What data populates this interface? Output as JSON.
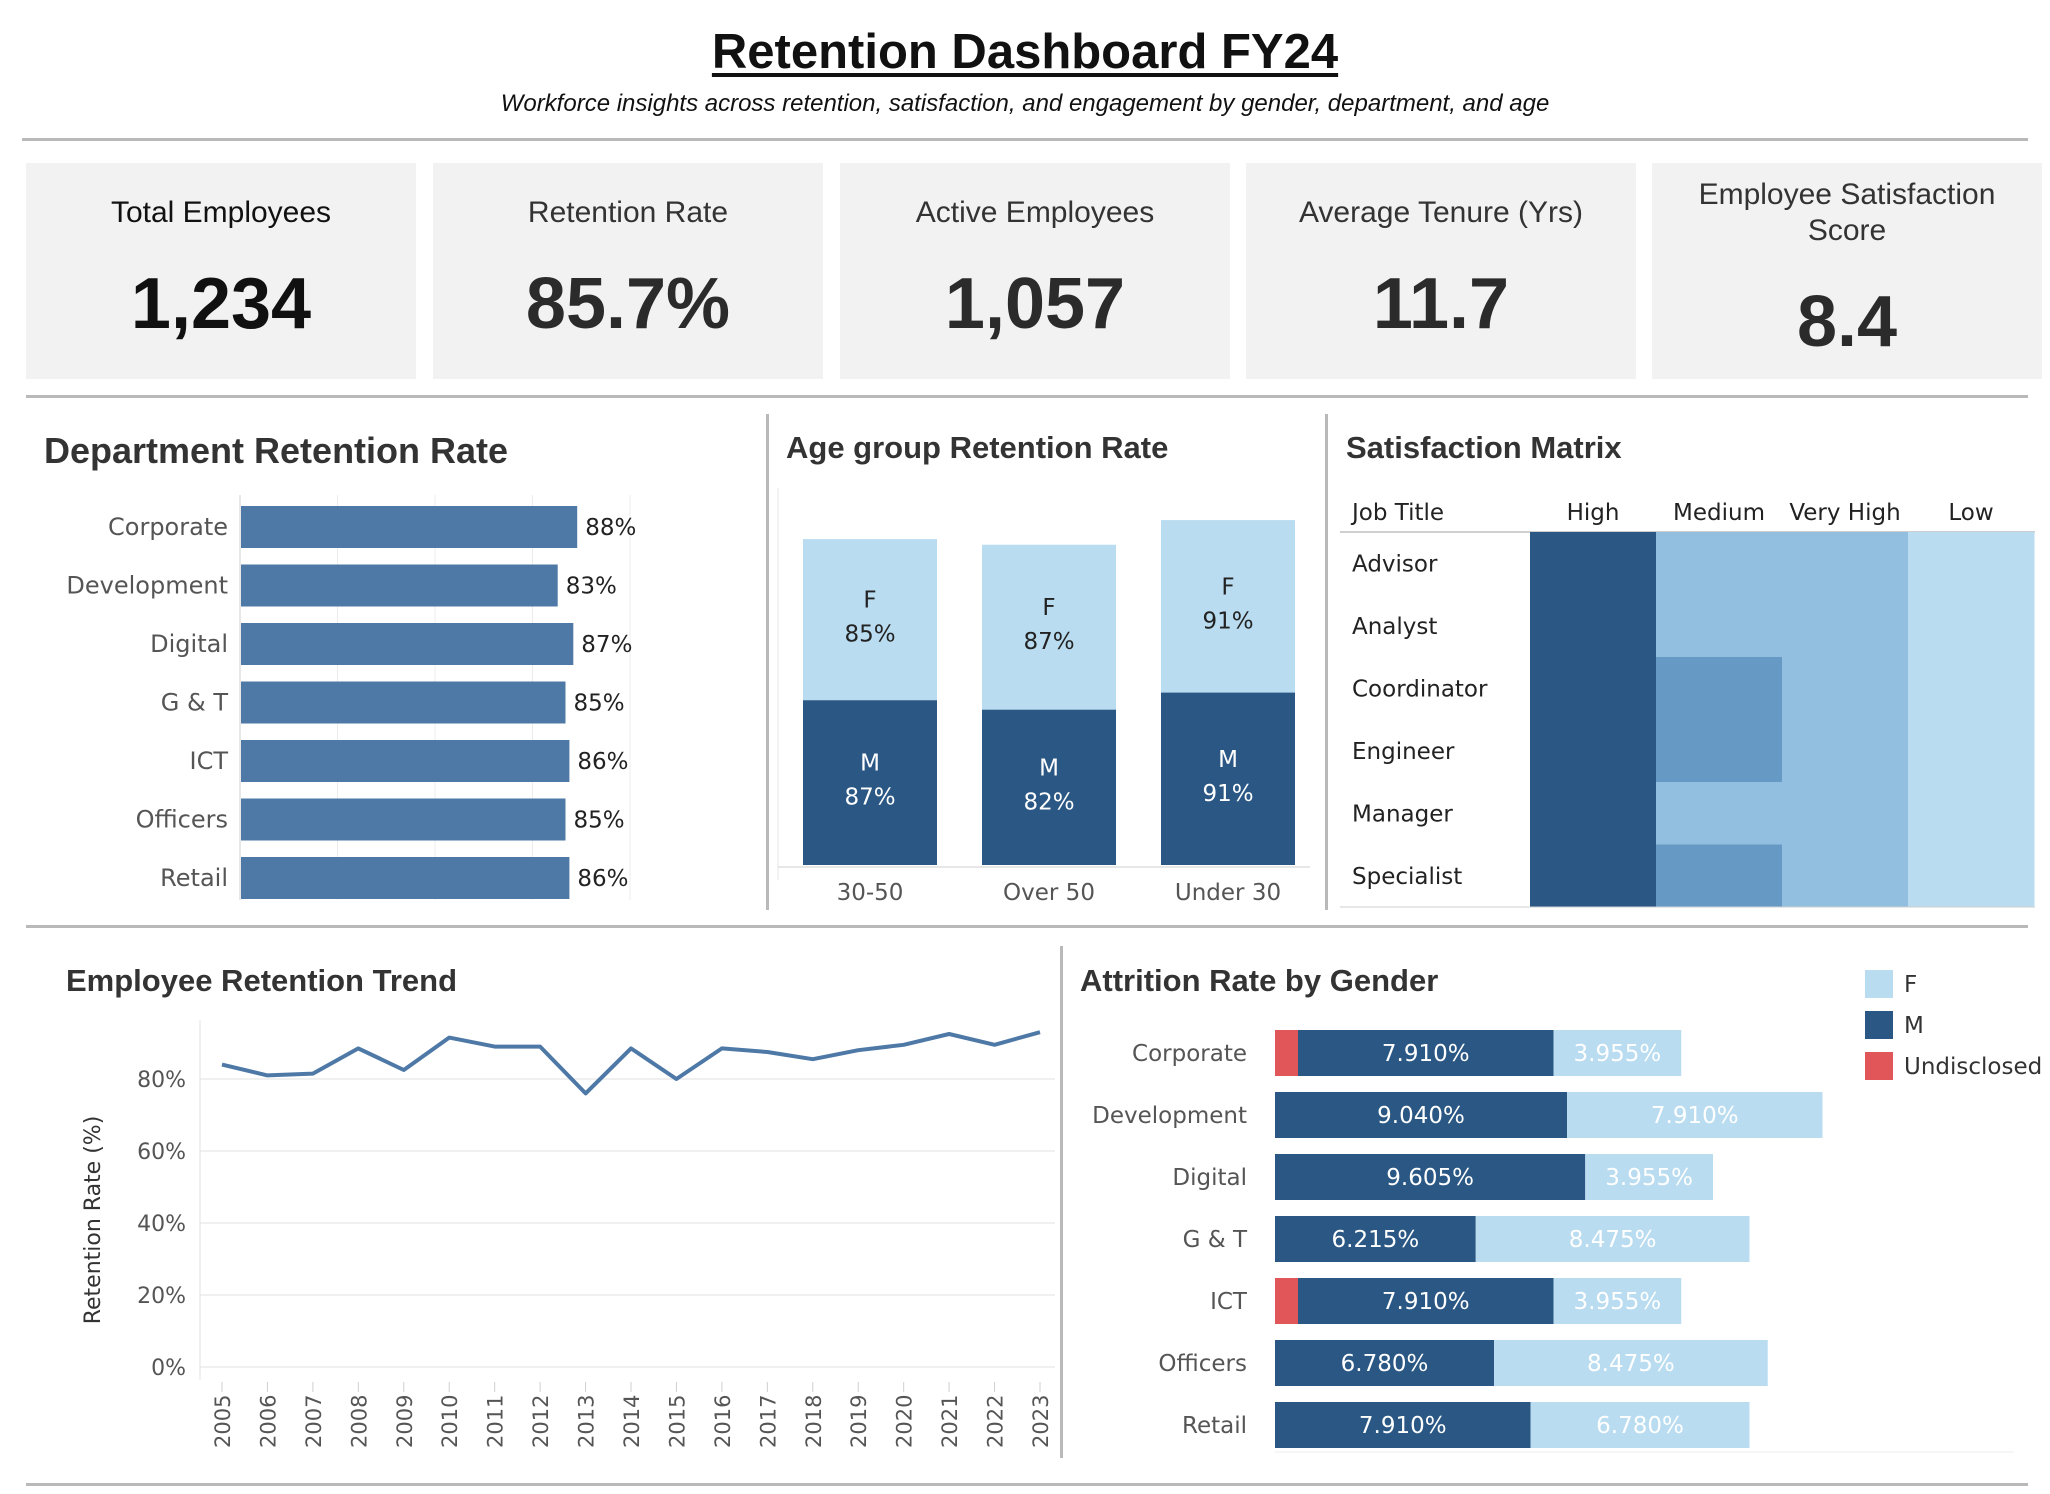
{
  "header": {
    "title": "Retention Dashboard FY24",
    "subtitle": "Workforce insights across retention, satisfaction, and engagement by gender, department, and age"
  },
  "kpis": [
    {
      "label": "Total Employees",
      "value": "1,234"
    },
    {
      "label": "Retention Rate",
      "value": "85.7%"
    },
    {
      "label": "Active Employees",
      "value": "1,057"
    },
    {
      "label": "Average Tenure (Yrs)",
      "value": "11.7"
    },
    {
      "label": "Employee Satisfaction Score",
      "value": "8.4"
    }
  ],
  "colors": {
    "bar_blue": "#4e79a7",
    "dark_blue": "#2a5783",
    "light_blue": "#b9dcf0",
    "mid_blue": "#6699c4",
    "matrix_light": "#92bfe0",
    "red": "#e15759",
    "line_blue": "#4e79a7"
  },
  "chart_data": [
    {
      "id": "dept",
      "type": "bar",
      "title": "Department Retention Rate",
      "orientation": "horizontal",
      "categories": [
        "Corporate",
        "Development",
        "Digital",
        "G & T",
        "ICT",
        "Officers",
        "Retail"
      ],
      "values": [
        88,
        83,
        87,
        85,
        86,
        85,
        86
      ],
      "value_labels": [
        "88%",
        "83%",
        "87%",
        "85%",
        "86%",
        "85%",
        "86%"
      ],
      "xlim": [
        0,
        100
      ]
    },
    {
      "id": "age",
      "type": "bar",
      "stacked": true,
      "title": "Age group Retention Rate",
      "categories": [
        "30-50",
        "Over 50",
        "Under 30"
      ],
      "series": [
        {
          "name": "M",
          "values": [
            87,
            82,
            91
          ],
          "labels": [
            "87%",
            "82%",
            "91%"
          ]
        },
        {
          "name": "F",
          "values": [
            85,
            87,
            91
          ],
          "labels": [
            "85%",
            "87%",
            "91%"
          ]
        }
      ]
    },
    {
      "id": "matrix",
      "type": "heatmap",
      "title": "Satisfaction Matrix",
      "row_header": "Job Title",
      "columns": [
        "High",
        "Medium",
        "Very High",
        "Low"
      ],
      "rows": [
        "Advisor",
        "Analyst",
        "Coordinator",
        "Engineer",
        "Manager",
        "Specialist"
      ],
      "levels": [
        [
          4,
          2,
          2,
          1
        ],
        [
          4,
          2,
          2,
          1
        ],
        [
          4,
          3,
          2,
          1
        ],
        [
          4,
          3,
          2,
          1
        ],
        [
          4,
          2,
          2,
          1
        ],
        [
          4,
          3,
          2,
          1
        ]
      ]
    },
    {
      "id": "trend",
      "type": "line",
      "title": "Employee Retention Trend",
      "ylabel": "Retention Rate (%)",
      "x": [
        "2005",
        "2006",
        "2007",
        "2008",
        "2009",
        "2010",
        "2011",
        "2012",
        "2013",
        "2014",
        "2015",
        "2016",
        "2017",
        "2018",
        "2019",
        "2020",
        "2021",
        "2022",
        "2023"
      ],
      "values": [
        84,
        81,
        81.5,
        88.5,
        82.5,
        91.5,
        89,
        89,
        76,
        88.5,
        80,
        88.5,
        87.5,
        85.5,
        88,
        89.5,
        92.5,
        89.5,
        93
      ],
      "ylim": [
        0,
        100
      ],
      "yticks": [
        "0%",
        "20%",
        "40%",
        "60%",
        "80%"
      ]
    },
    {
      "id": "attrition",
      "type": "bar",
      "stacked": true,
      "orientation": "horizontal",
      "title": "Attrition Rate by Gender",
      "categories": [
        "Corporate",
        "Development",
        "Digital",
        "G & T",
        "ICT",
        "Officers",
        "Retail"
      ],
      "legend": [
        "F",
        "M",
        "Undisclosed"
      ],
      "legend_position": "top-right",
      "series": [
        {
          "name": "Undisclosed",
          "values": [
            0.565,
            0,
            0,
            0,
            0.565,
            0,
            0
          ]
        },
        {
          "name": "M",
          "values": [
            7.91,
            9.04,
            9.605,
            6.215,
            7.91,
            6.78,
            7.91
          ],
          "labels": [
            "7.910%",
            "9.040%",
            "9.605%",
            "6.215%",
            "7.910%",
            "6.780%",
            "7.910%"
          ]
        },
        {
          "name": "F",
          "values": [
            3.955,
            7.91,
            3.955,
            8.475,
            3.955,
            8.475,
            6.78
          ],
          "labels": [
            "3.955%",
            "7.910%",
            "3.955%",
            "8.475%",
            "3.955%",
            "8.475%",
            "6.780%"
          ]
        }
      ]
    }
  ]
}
